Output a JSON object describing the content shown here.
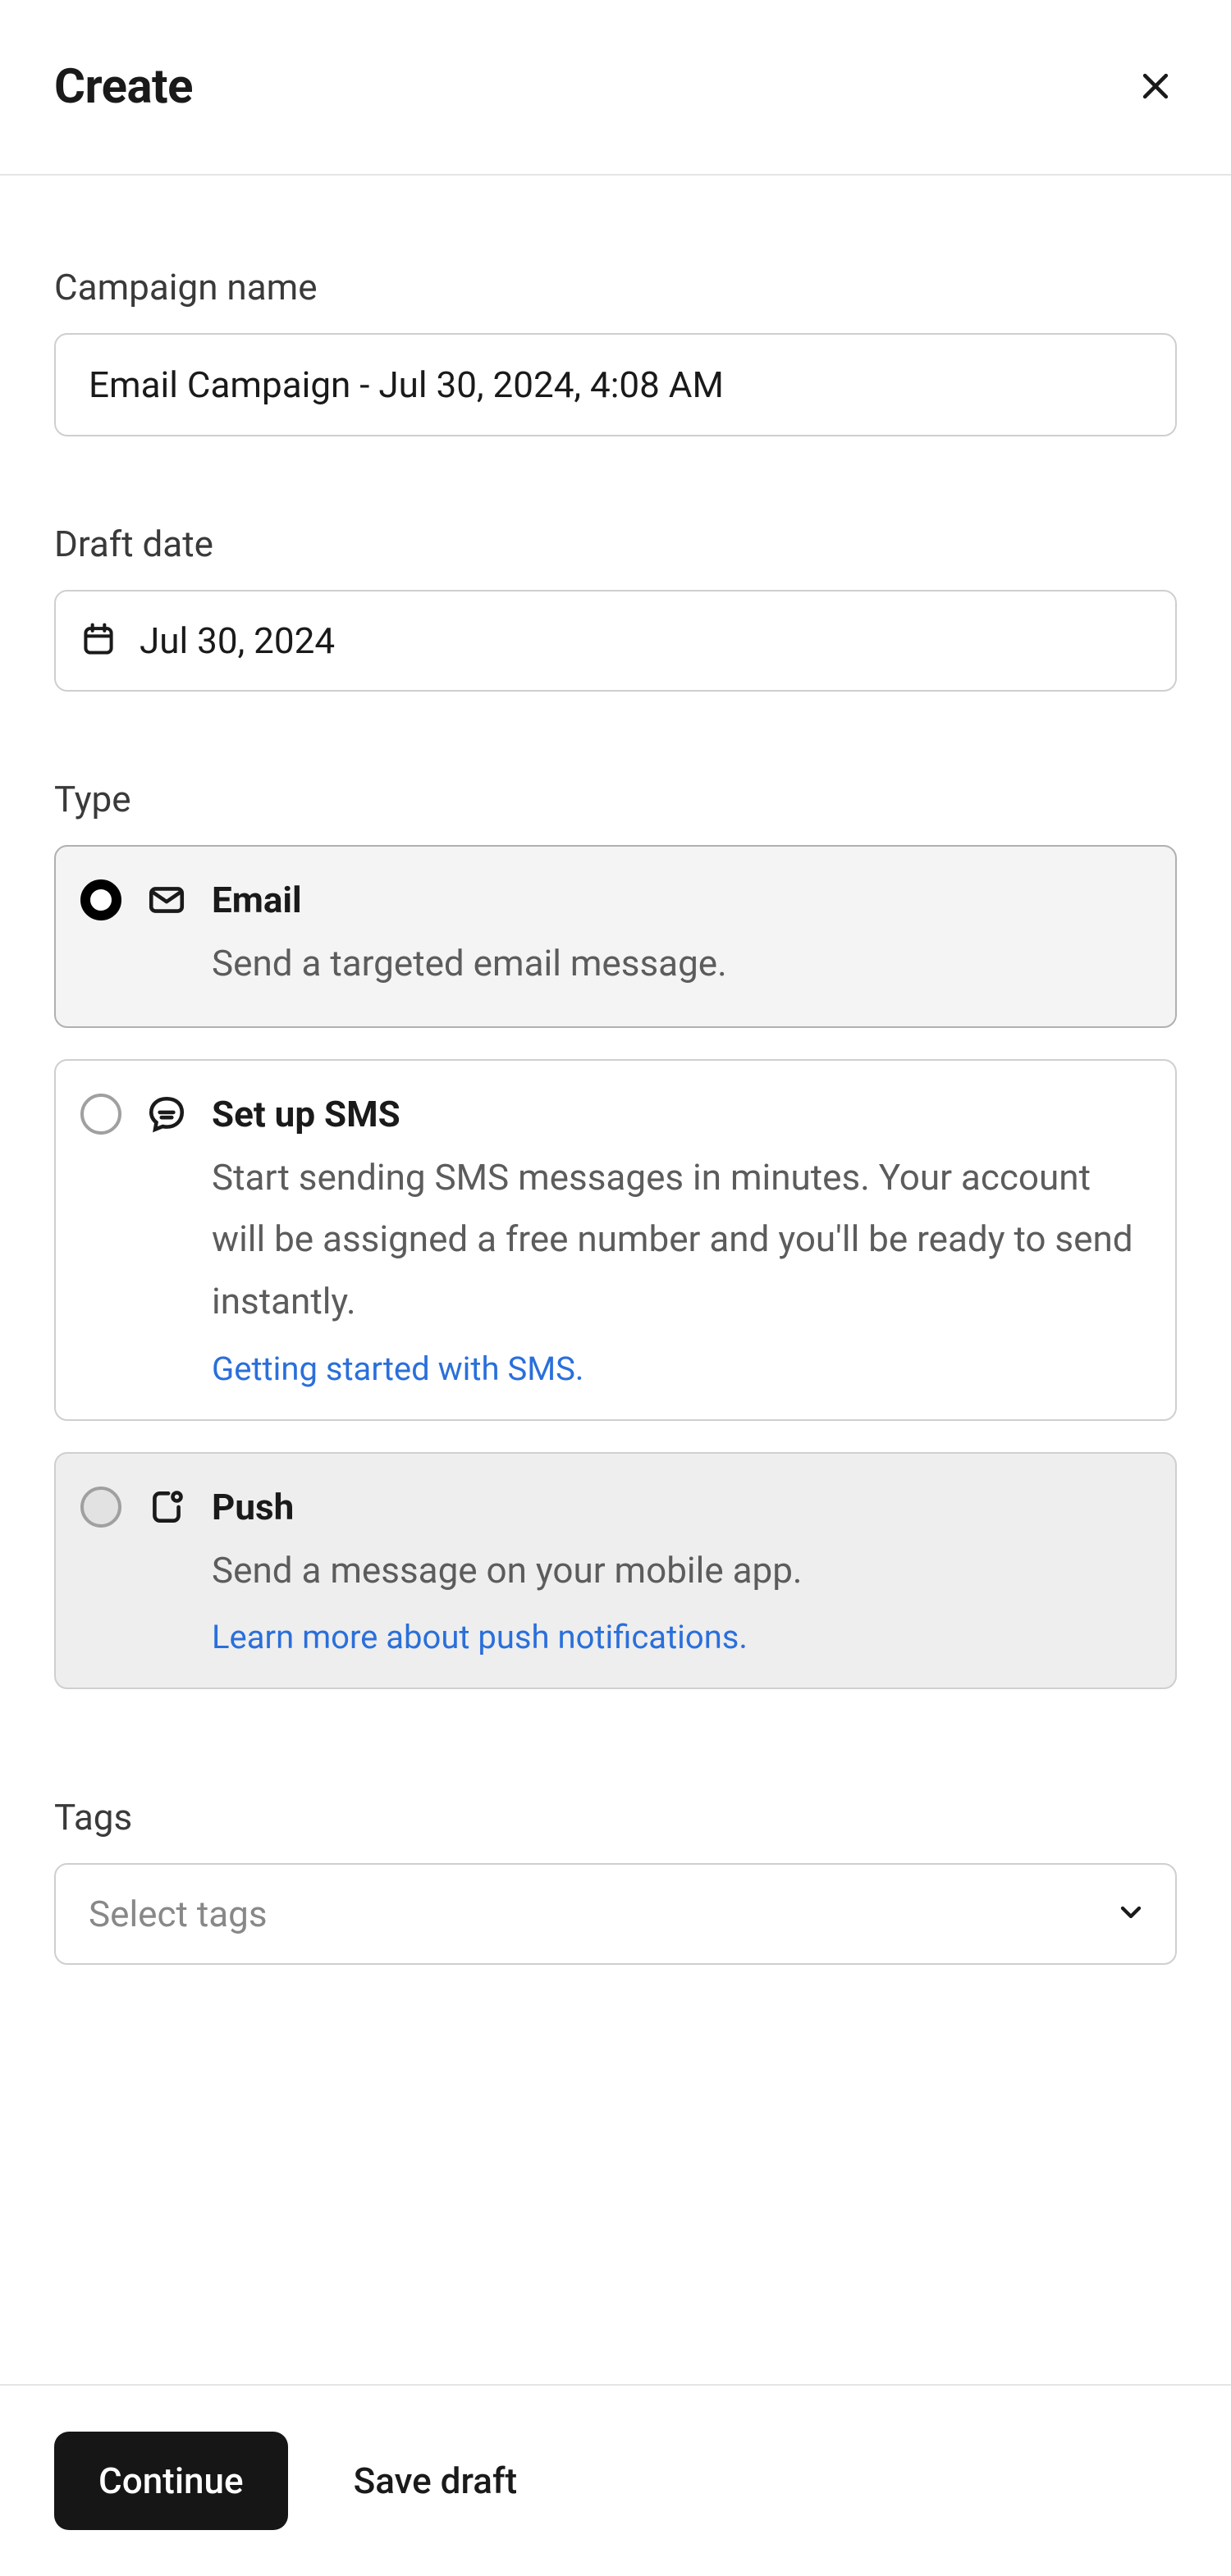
{
  "header": {
    "title": "Create"
  },
  "campaignName": {
    "label": "Campaign name",
    "value": "Email Campaign - Jul 30, 2024, 4:08 AM"
  },
  "draftDate": {
    "label": "Draft date",
    "value": "Jul 30, 2024"
  },
  "type": {
    "label": "Type",
    "options": [
      {
        "title": "Email",
        "desc": "Send a targeted email message.",
        "link": null
      },
      {
        "title": "Set up SMS",
        "desc": "Start sending SMS messages in minutes. Your account will be assigned a free number and you'll be ready to send instantly.",
        "link": "Getting started with SMS."
      },
      {
        "title": "Push",
        "desc": "Send a message on your mobile app.",
        "link": "Learn more about push notifications."
      }
    ]
  },
  "tags": {
    "label": "Tags",
    "placeholder": "Select tags"
  },
  "footer": {
    "continue": "Continue",
    "save_draft": "Save draft"
  }
}
